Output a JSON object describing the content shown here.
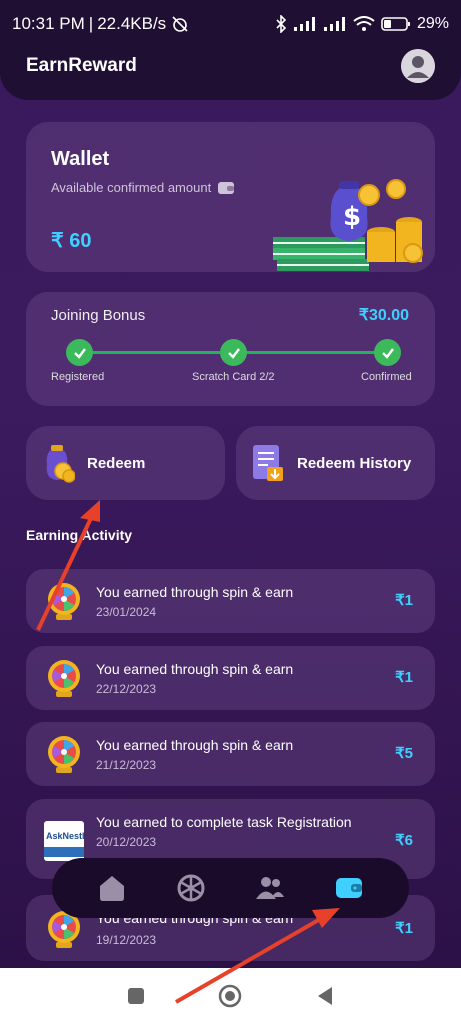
{
  "status": {
    "time": "10:31 PM",
    "speed": "22.4KB/s",
    "battery": "29%"
  },
  "header": {
    "title": "EarnReward"
  },
  "wallet": {
    "title": "Wallet",
    "subtitle": "Available confirmed amount",
    "amount": "₹ 60"
  },
  "bonus": {
    "title": "Joining Bonus",
    "amount": "₹30.00",
    "steps": [
      "Registered",
      "Scratch Card 2/2",
      "Confirmed"
    ]
  },
  "actions": {
    "redeem": "Redeem",
    "history": "Redeem History"
  },
  "activity": {
    "section_title": "Earning Activity",
    "items": [
      {
        "title": "You earned through spin & earn",
        "date": "23/01/2024",
        "amount": "₹1",
        "icon": "spin-wheel-icon"
      },
      {
        "title": "You earned through spin & earn",
        "date": "22/12/2023",
        "amount": "₹1",
        "icon": "spin-wheel-icon"
      },
      {
        "title": "You earned through spin & earn",
        "date": "21/12/2023",
        "amount": "₹5",
        "icon": "spin-wheel-icon"
      },
      {
        "title": "You earned to complete task Registration",
        "date": "20/12/2023",
        "amount": "₹6",
        "icon": "asknestle-logo"
      },
      {
        "title": "You earned through spin & earn",
        "date": "19/12/2023",
        "amount": "₹1",
        "icon": "spin-wheel-icon"
      }
    ]
  },
  "logo_text": "AskNestle",
  "nav": [
    "home-icon",
    "spin-icon",
    "users-icon",
    "wallet-icon"
  ],
  "colors": {
    "accent": "#3fd0ff",
    "check": "#3cb95a",
    "annotation_arrow": "#e8412a"
  }
}
